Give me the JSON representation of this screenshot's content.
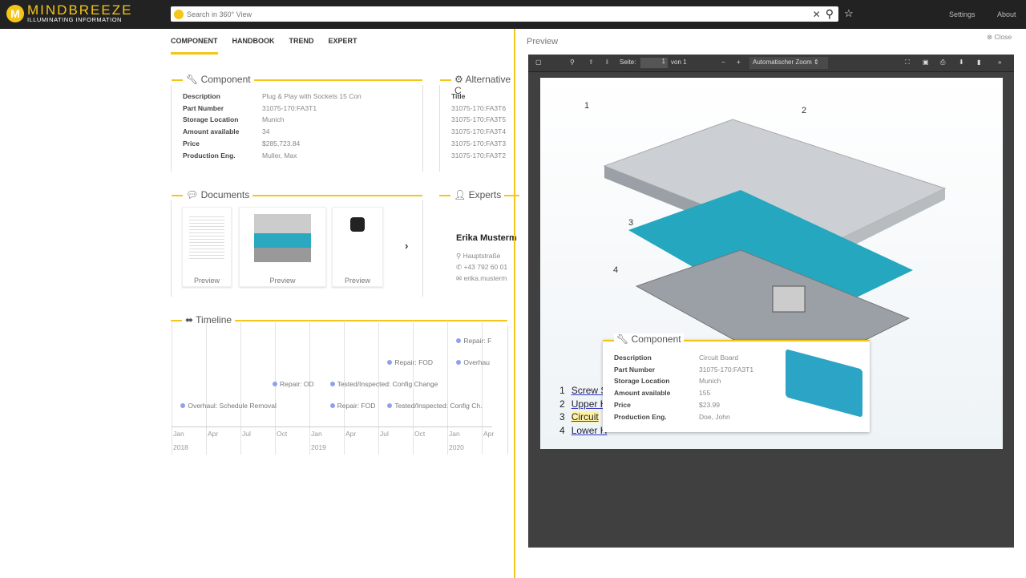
{
  "header": {
    "brand": "MINDBREEZE",
    "tagline": "ILLUMINATING INFORMATION",
    "search_placeholder": "Search in 360° View",
    "settings": "Settings",
    "about": "About"
  },
  "tabs": [
    "COMPONENT",
    "HANDBOOK",
    "TREND",
    "EXPERT"
  ],
  "component": {
    "title": "Component",
    "rows": [
      [
        "Description",
        "Plug & Play with Sockets 15 Con"
      ],
      [
        "Part Number",
        "31075-170:FA3T1"
      ],
      [
        "Storage Location",
        "Munich"
      ],
      [
        "Amount available",
        "34"
      ],
      [
        "Price",
        "$285,723.84"
      ],
      [
        "Production Eng.",
        "Muller, Max"
      ]
    ]
  },
  "alternative": {
    "title": "Alternative C",
    "header": "Title",
    "items": [
      "31075-170:FA3T6",
      "31075-170:FA3T5",
      "31075-170:FA3T4",
      "31075-170:FA3T3",
      "31075-170:FA3T2"
    ]
  },
  "documents": {
    "title": "Documents",
    "items": [
      "Preview",
      "Preview",
      "Preview"
    ]
  },
  "experts": {
    "title": "Experts",
    "name": "Erika Musterm",
    "address": "Hauptstraße",
    "phone": "+43 792 60 01",
    "email": "erika.musterm"
  },
  "timeline": {
    "title": "Timeline",
    "ticks": [
      "Jan",
      "Apr",
      "Jul",
      "Oct",
      "Jan",
      "Apr",
      "Jul",
      "Oct",
      "Jan",
      "Apr"
    ],
    "years": [
      "2018",
      "2019",
      "2020"
    ],
    "events": [
      {
        "label": "Overhaul: Schedule Removal",
        "date": "2018-02",
        "row": 4
      },
      {
        "label": "Repair: OD",
        "date": "2018-10",
        "row": 3
      },
      {
        "label": "Repair: FOD",
        "date": "2019-03",
        "row": 4
      },
      {
        "label": "Tested/Inspected: Config Change",
        "date": "2019-03",
        "row": 3
      },
      {
        "label": "Repair: FOD",
        "date": "2019-08",
        "row": 2
      },
      {
        "label": "Tested/Inspected: Config Ch.",
        "date": "2019-08",
        "row": 4
      },
      {
        "label": "Repair: F",
        "date": "2020-02",
        "row": 1
      },
      {
        "label": "Overhau",
        "date": "2020-02",
        "row": 2
      }
    ]
  },
  "preview": {
    "title": "Preview",
    "close": "Close",
    "page_label": "Seite:",
    "page": "1",
    "of": "von 1",
    "zoom": "Automatischer Zoom"
  },
  "drawing": {
    "callouts": [
      "1",
      "2",
      "3",
      "4"
    ],
    "legend": [
      [
        "1",
        "Screw S"
      ],
      [
        "2",
        "Upper H"
      ],
      [
        "3",
        "Circuit"
      ],
      [
        "4",
        "Lower H"
      ]
    ]
  },
  "popup": {
    "title": "Component",
    "rows": [
      [
        "Description",
        "Circuit Board"
      ],
      [
        "Part Number",
        "31075-170:FA3T1"
      ],
      [
        "Storage Location",
        "Munich"
      ],
      [
        "Amount available",
        "155"
      ],
      [
        "Price",
        "$23.99"
      ],
      [
        "Production Eng.",
        "Doe, John"
      ]
    ]
  },
  "colors": {
    "accent": "#f5c518",
    "header": "#222222",
    "timeline_dot": "#8fa0ef"
  }
}
